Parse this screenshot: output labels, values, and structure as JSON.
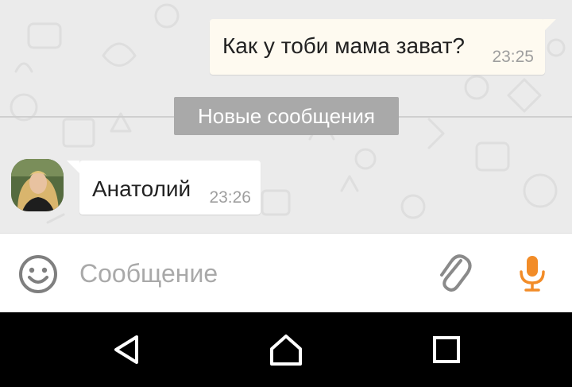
{
  "chat": {
    "messages": [
      {
        "direction": "outgoing",
        "text": "Как у тоби мама зават?",
        "time": "23:25"
      },
      {
        "direction": "incoming",
        "text": "Анатолий",
        "time": "23:26"
      }
    ],
    "new_messages_label": "Новые сообщения"
  },
  "input_bar": {
    "placeholder": "Сообщение",
    "value": "",
    "icons": {
      "emoji": "smiley-icon",
      "attach": "paperclip-icon",
      "mic": "microphone-icon"
    }
  },
  "nav_bar": {
    "icons": [
      "back-icon",
      "home-icon",
      "recents-icon"
    ]
  },
  "colors": {
    "chat_background": "#ebebeb",
    "outgoing_bubble": "#fefaf0",
    "incoming_bubble": "#ffffff",
    "badge": "#a9a9a9",
    "accent_mic": "#f28c28",
    "icon_gray": "#8a8a8a",
    "nav_background": "#000000"
  }
}
